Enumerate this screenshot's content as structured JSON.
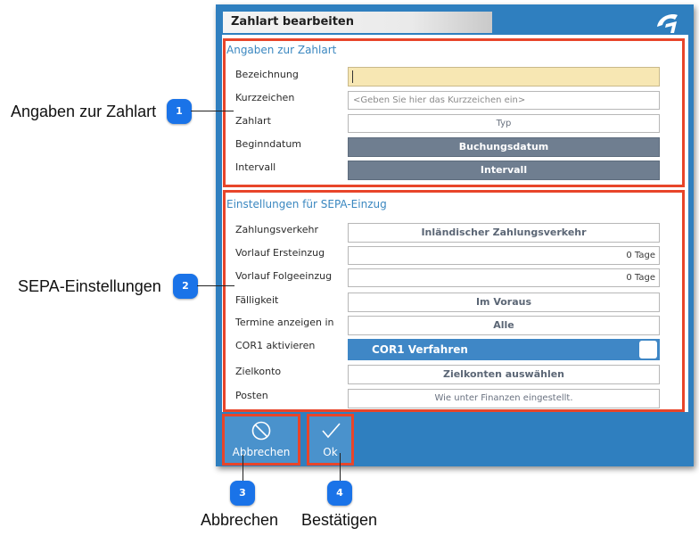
{
  "dialog": {
    "title": "Zahlart bearbeiten",
    "logo_icon": "app-logo-icon"
  },
  "section1": {
    "heading": "Angaben zur Zahlart",
    "rows": [
      {
        "label": "Bezeichnung",
        "value": ""
      },
      {
        "label": "Kurzzeichen",
        "placeholder": "<Geben Sie hier das Kurzzeichen ein>"
      },
      {
        "label": "Zahlart",
        "value": "Typ"
      },
      {
        "label": "Beginndatum",
        "button": "Buchungsdatum"
      },
      {
        "label": "Intervall",
        "button": "Intervall"
      }
    ]
  },
  "section2": {
    "heading": "Einstellungen für SEPA-Einzug",
    "rows": [
      {
        "label": "Zahlungsverkehr",
        "value": "Inländischer Zahlungsverkehr"
      },
      {
        "label": "Vorlauf Ersteinzug",
        "value": "0 Tage"
      },
      {
        "label": "Vorlauf Folgeeinzug",
        "value": "0 Tage"
      },
      {
        "label": "Fälligkeit",
        "value": "Im Voraus"
      },
      {
        "label": "Termine anzeigen in",
        "value": "Alle"
      },
      {
        "label": "COR1 aktivieren",
        "toggle_label": "COR1 Verfahren",
        "checked": false
      },
      {
        "label": "Zielkonto",
        "value": "Zielkonten auswählen"
      },
      {
        "label": "Posten",
        "value": "Wie unter Finanzen eingestellt."
      }
    ]
  },
  "footer": {
    "cancel_label": "Abbrechen",
    "cancel_icon": "cancel-circle-icon",
    "ok_label": "Ok",
    "ok_icon": "checkmark-icon"
  },
  "callouts": [
    {
      "number": "1",
      "text": "Angaben zur Zahlart"
    },
    {
      "number": "2",
      "text": "SEPA-Einstellungen"
    },
    {
      "number": "3",
      "text": "Abbrechen"
    },
    {
      "number": "4",
      "text": "Bestätigen"
    }
  ],
  "colors": {
    "dialog_blue": "#2f7fbf",
    "highlight": "#e8452a",
    "callout_blue": "#1a73e8",
    "input_yellow": "#f7e7b3"
  }
}
